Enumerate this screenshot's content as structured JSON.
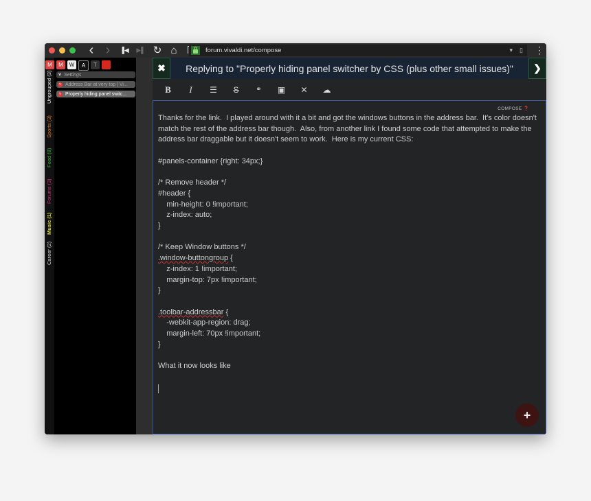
{
  "browser": {
    "url": "forum.vivaldi.net/compose",
    "nav": {
      "back": "‹",
      "forward": "›",
      "rewind": "⏮",
      "fastforward": "⏭",
      "reload": "↻",
      "home": "⌂",
      "bookmark": "🔖"
    },
    "addr_dropdown": "▾",
    "addr_bookmark": "▯",
    "menu": "⋮"
  },
  "panel": {
    "icons": [
      "gmail-icon",
      "gmail-icon",
      "wp-icon",
      "font-icon",
      "nyt-icon",
      "red-square-icon"
    ],
    "icon_glyphs": [
      "M",
      "M",
      "W",
      "A",
      "T",
      ""
    ],
    "vertical_tabs": [
      {
        "label": "Ungrouped (3)",
        "color": "#e0e0e0"
      },
      {
        "label": "Sports (3)",
        "color": "#d27a2c"
      },
      {
        "label": "Food (8)",
        "color": "#3fae3f"
      },
      {
        "label": "Forums (3)",
        "color": "#d0307a"
      },
      {
        "label": "Music (1)",
        "color": "#d8d83a"
      },
      {
        "label": "Career (2)",
        "color": "#d0d0d0"
      }
    ],
    "tabs": [
      {
        "label": "Settings",
        "type": "settings"
      },
      {
        "label": "Address Bar at very top | Vi...",
        "type": "page"
      },
      {
        "label": "Properly hiding panel switc...",
        "type": "page"
      }
    ]
  },
  "compose": {
    "close": "✖",
    "title": "Replying to \"Properly hiding panel switcher by CSS (plus other small issues)\"",
    "next": "❯",
    "toolbar": [
      {
        "name": "bold-button",
        "glyph": "B"
      },
      {
        "name": "italic-button",
        "glyph": "I"
      },
      {
        "name": "list-button",
        "glyph": "☰"
      },
      {
        "name": "strikethrough-button",
        "glyph": "S"
      },
      {
        "name": "link-button",
        "glyph": "🔗"
      },
      {
        "name": "image-button",
        "glyph": "▣"
      },
      {
        "name": "fullscreen-button",
        "glyph": "⤧"
      },
      {
        "name": "upload-button",
        "glyph": "☁"
      }
    ],
    "compose_label": "COMPOSE ❓",
    "body_parts": [
      "Thanks for the link.  I played around with it a bit and got the windows buttons in the address bar.  It's color doesn't match the rest of the address bar though.  Also, from another link I found some code that attempted to make the address bar draggable but it doesn't seem to work.  Here is my current CSS:\n\n#panels-container {right: 34px;}\n\n/* Remove header */\n#header {\n    min-height: 0 !important;\n    z-index: auto;\n}\n\n/* Keep Window buttons */\n",
      ".window-buttongroup",
      " {\n    z-index: 1 !important;\n    margin-top: 7px !important;\n}\n\n",
      ".toolbar-addressbar",
      " {\n    -webkit-app-region: drag;\n    margin-left: 70px !important;\n}\n\nWhat it now looks like"
    ],
    "fab": "+"
  }
}
